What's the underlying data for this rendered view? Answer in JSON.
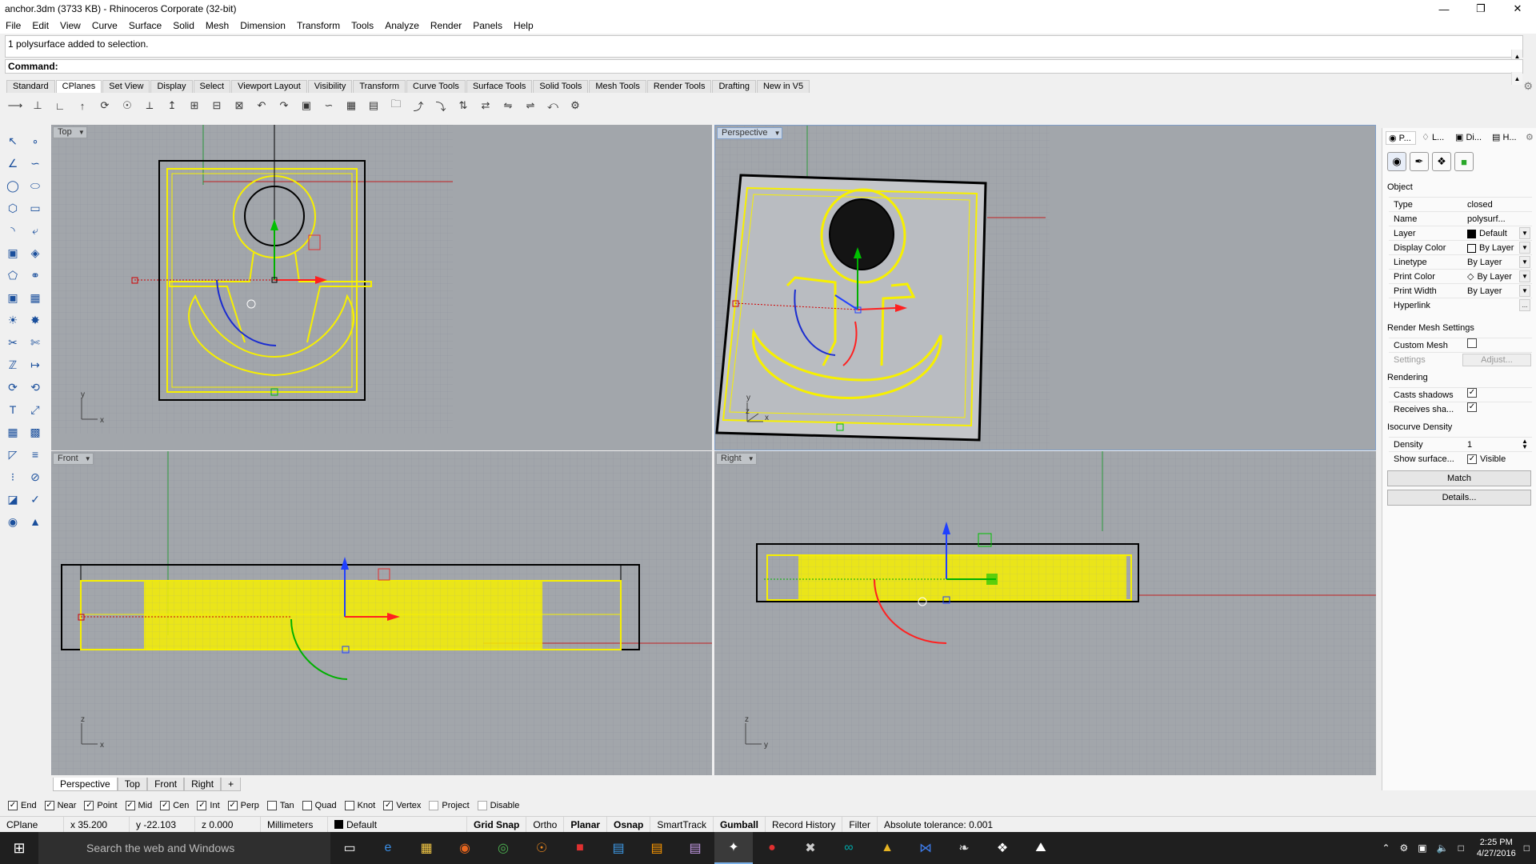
{
  "window": {
    "title": "anchor.3dm (3733 KB) - Rhinoceros Corporate (32-bit)"
  },
  "menu": [
    "File",
    "Edit",
    "View",
    "Curve",
    "Surface",
    "Solid",
    "Mesh",
    "Dimension",
    "Transform",
    "Tools",
    "Analyze",
    "Render",
    "Panels",
    "Help"
  ],
  "command": {
    "history": "1 polysurface added to selection.",
    "prompt": "Command:"
  },
  "toolbar_tabs": [
    "Standard",
    "CPlanes",
    "Set View",
    "Display",
    "Select",
    "Viewport Layout",
    "Visibility",
    "Transform",
    "Curve Tools",
    "Surface Tools",
    "Solid Tools",
    "Mesh Tools",
    "Render Tools",
    "Drafting",
    "New in V5"
  ],
  "active_toolbar_tab": "CPlanes",
  "viewports": {
    "top": {
      "label": "Top",
      "axis_x": "x",
      "axis_y": "y"
    },
    "perspective": {
      "label": "Perspective",
      "axis_x": "x",
      "axis_y": "y",
      "axis_z": "z"
    },
    "front": {
      "label": "Front",
      "axis_x": "x",
      "axis_y": "z"
    },
    "right": {
      "label": "Right",
      "axis_x": "y",
      "axis_y": "z"
    }
  },
  "viewport_tabs": [
    "Perspective",
    "Top",
    "Front",
    "Right"
  ],
  "viewport_add": "+",
  "osnaps": [
    {
      "label": "End",
      "checked": true
    },
    {
      "label": "Near",
      "checked": true
    },
    {
      "label": "Point",
      "checked": true
    },
    {
      "label": "Mid",
      "checked": true
    },
    {
      "label": "Cen",
      "checked": true
    },
    {
      "label": "Int",
      "checked": true
    },
    {
      "label": "Perp",
      "checked": true
    },
    {
      "label": "Tan",
      "checked": false
    },
    {
      "label": "Quad",
      "checked": false
    },
    {
      "label": "Knot",
      "checked": false
    },
    {
      "label": "Vertex",
      "checked": true
    },
    {
      "label": "Project",
      "checked": false
    },
    {
      "label": "Disable",
      "checked": false
    }
  ],
  "status": {
    "cplane": "CPlane",
    "x": "x 35.200",
    "y": "y -22.103",
    "z": "z 0.000",
    "units": "Millimeters",
    "layer": "Default",
    "grid_snap": "Grid Snap",
    "ortho": "Ortho",
    "planar": "Planar",
    "osnap": "Osnap",
    "smarttrack": "SmartTrack",
    "gumball": "Gumball",
    "record_history": "Record History",
    "filter": "Filter",
    "tolerance": "Absolute tolerance: 0.001"
  },
  "panel": {
    "tabs": [
      "P...",
      "L...",
      "Di...",
      "H..."
    ],
    "object_header": "Object",
    "rows": [
      {
        "k": "Type",
        "v": "closed polysurf..."
      },
      {
        "k": "Name",
        "v": ""
      },
      {
        "k": "Layer",
        "v": "Default"
      },
      {
        "k": "Display Color",
        "v": "By Layer"
      },
      {
        "k": "Linetype",
        "v": "By Layer"
      },
      {
        "k": "Print Color",
        "v": "By Layer"
      },
      {
        "k": "Print Width",
        "v": "By Layer"
      },
      {
        "k": "Hyperlink",
        "v": ""
      }
    ],
    "hyperlink_btn": "...",
    "render_mesh_header": "Render Mesh Settings",
    "custom_mesh": "Custom Mesh",
    "settings": "Settings",
    "adjust": "Adjust...",
    "rendering_header": "Rendering",
    "casts_shadows": "Casts shadows",
    "receives_shadows": "Receives sha...",
    "isocurve_header": "Isocurve Density",
    "density_label": "Density",
    "density_value": "1",
    "show_surface": "Show surface...",
    "visible": "Visible",
    "match": "Match",
    "details": "Details..."
  },
  "taskbar": {
    "search": "Search the web and Windows",
    "time": "2:25 PM",
    "date": "4/27/2016"
  },
  "colors": {
    "viewport_bg": "#a2a6ab",
    "object": "#f7f000",
    "gumball_x": "#ff2020",
    "gumball_y": "#00c020",
    "gumball_z": "#2040ff"
  }
}
